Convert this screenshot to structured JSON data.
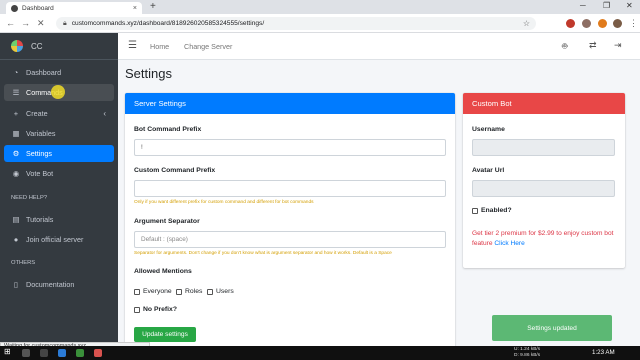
{
  "browser": {
    "tab_title": "Dashboard",
    "tab_close": "×",
    "new_tab": "+",
    "url": "customcommands.xyz/dashboard/818926020585324555/settings/"
  },
  "brand": {
    "name": "CC"
  },
  "sidebar": {
    "items": [
      {
        "label": "Dashboard",
        "icon": "gauge-icon",
        "glyph": "◔"
      },
      {
        "label": "Commands",
        "icon": "list-icon",
        "glyph": "☰"
      },
      {
        "label": "Create",
        "icon": "plus-icon",
        "glyph": "+"
      },
      {
        "label": "Variables",
        "icon": "variable-icon",
        "glyph": "▦"
      },
      {
        "label": "Settings",
        "icon": "gear-icon",
        "glyph": "⚙"
      },
      {
        "label": "Vote Bot",
        "icon": "vote-icon",
        "glyph": "◉"
      }
    ],
    "section_help": "NEED HELP?",
    "help_items": [
      {
        "label": "Tutorials",
        "icon": "book-icon",
        "glyph": "▤"
      },
      {
        "label": "Join official server",
        "icon": "users-icon",
        "glyph": "●"
      }
    ],
    "section_others": "OTHERS",
    "other_items": [
      {
        "label": "Documentation",
        "icon": "document-icon",
        "glyph": "▯"
      }
    ]
  },
  "topbar": {
    "home": "Home",
    "change_server": "Change Server"
  },
  "page": {
    "title": "Settings"
  },
  "server_settings": {
    "header": "Server Settings",
    "header_color": "#007bff",
    "prefix_label": "Bot Command Prefix",
    "prefix_value": "!",
    "custom_prefix_label": "Custom Command Prefix",
    "custom_prefix_value": "",
    "custom_prefix_help": "Only if you want different prefix for custom command and different for bot commands",
    "separator_label": "Argument Separator",
    "separator_placeholder": "Default : (space)",
    "separator_help": "Separator for arguments. Don't change if you don't know what is argument separator and how it works. Default is a Space",
    "mentions_label": "Allowed Mentions",
    "mentions": [
      "Everyone",
      "Roles",
      "Users"
    ],
    "no_prefix_label": "No Prefix?",
    "update_button": "Update settings"
  },
  "custom_bot": {
    "header": "Custom Bot",
    "header_color": "#e84747",
    "username_label": "Username",
    "avatar_label": "Avatar Url",
    "enabled_label": "Enabled?",
    "promo_text": "Get tier 2 premium for $2.99 to enjoy custom bot feature",
    "promo_link": "Click Here"
  },
  "toast": {
    "message": "Settings updated"
  },
  "status_bar": {
    "text": "Waiting for customcommands.xyz..."
  },
  "taskbar": {
    "net_up": "1.24 kB/s",
    "net_down": "9.86 kB/s",
    "net_u_label": "U:",
    "net_d_label": "D:",
    "time": "1:23 AM"
  }
}
